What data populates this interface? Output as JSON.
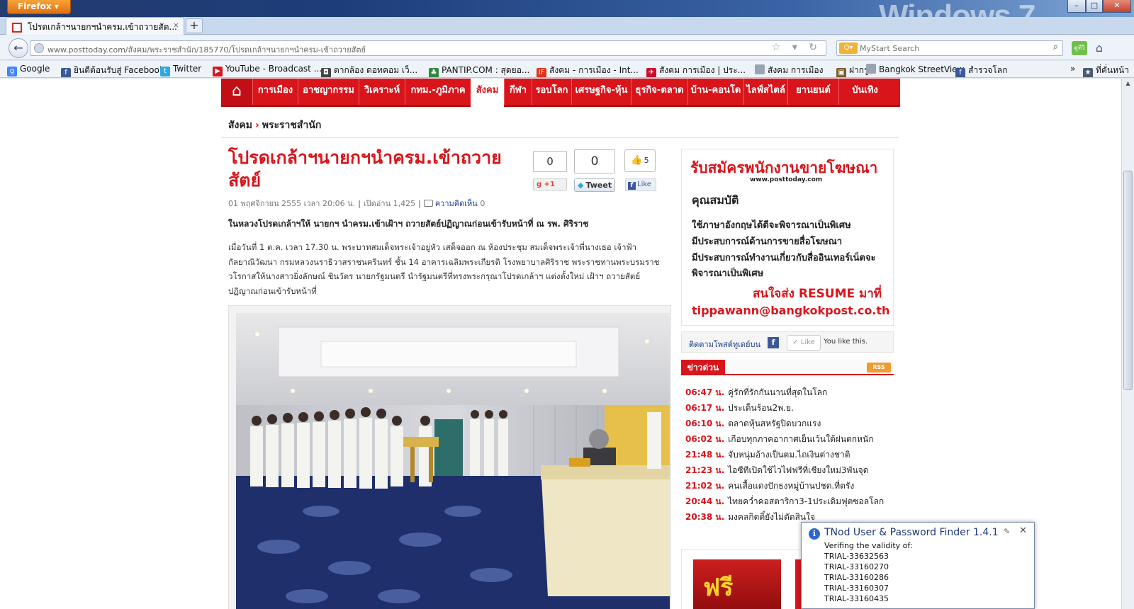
{
  "window": {
    "app_button": "Firefox",
    "os_logo": "Windows 7",
    "controls": {
      "minimize": "–",
      "restore": "□",
      "close": "✕"
    }
  },
  "tab": {
    "title": "โปรดเกล้าฯนายกฯนำครม.เข้าถวายสัต...",
    "close": "×",
    "new_tab": "+"
  },
  "nav": {
    "back": "←",
    "url": "www.posttoday.com/สังคม/พระราชสำนัก/185770/โปรดเกล้าฯนายกฯนำครม-เข้าถวายสัตย์",
    "url_icons": "☆ ▾ ↻",
    "search_placeholder": "MyStart Search",
    "search_icon": "⌕",
    "addon_label": "ดูทีวี",
    "home_icon": "⌂"
  },
  "bookmarks": [
    {
      "label": "Google",
      "icon": "google-icon",
      "color": "#4285f4",
      "glyph": "g"
    },
    {
      "label": "ยินดีต้อนรับสู่ Facebook",
      "icon": "facebook-icon",
      "color": "#3b5998",
      "glyph": "f"
    },
    {
      "label": "Twitter",
      "icon": "twitter-icon",
      "color": "#2fa8e0",
      "glyph": "t"
    },
    {
      "label": "YouTube - Broadcast ...",
      "icon": "youtube-icon",
      "color": "#d9151c",
      "glyph": "▶"
    },
    {
      "label": "ตากล้อง ดอทคอม เว็...",
      "icon": "camera-icon",
      "color": "#444444",
      "glyph": "◘"
    },
    {
      "label": "PANTIP.COM : สุดยอ...",
      "icon": "pantip-icon",
      "color": "#2e8b3e",
      "glyph": "♣"
    },
    {
      "label": "สังคม - การเมือง - Int...",
      "icon": "if-icon",
      "color": "#e3331c",
      "glyph": "IF"
    },
    {
      "label": "สังคม การเมือง | ประ...",
      "icon": "bird-icon",
      "color": "#c8102e",
      "glyph": "✈"
    },
    {
      "label": "สังคม การเมือง",
      "icon": "page-icon",
      "color": "#9aa4b0",
      "glyph": ""
    },
    {
      "label": "ฝากรูป",
      "icon": "photo-icon",
      "color": "#7a5c2e",
      "glyph": "▣"
    },
    {
      "label": "Bangkok StreetView",
      "icon": "page-icon",
      "color": "#9aa4b0",
      "glyph": ""
    },
    {
      "label": "สำรวจโลก",
      "icon": "facebook-icon",
      "color": "#3b5998",
      "glyph": "f"
    }
  ],
  "bookmarks_more": "»",
  "bookmarks_menu": "ที่คั่นหน้า",
  "site_nav": {
    "home_icon": "⌂",
    "items": [
      "การเมือง",
      "อาชญากรรม",
      "วิเคราะห์",
      "กทม.-ภูมิภาค",
      "สังคม",
      "กีฬา",
      "รอบโลก",
      "เศรษฐกิจ-หุ้น",
      "ธุรกิจ-ตลาด",
      "บ้าน-คอนโด",
      "ไลฟ์สไตล์",
      "ยานยนต์",
      "บันเทิง"
    ],
    "active": "สังคม"
  },
  "breadcrumb": {
    "section": "สังคม",
    "separator": "›",
    "subsection": "พระราชสำนัก"
  },
  "article": {
    "title": "โปรดเกล้าฯนายกฯนำครม.เข้าถวายสัตย์",
    "date": "01 พฤศจิกายน 2555 เวลา 20:06 น.",
    "views": "เปิดอ่าน 1,425",
    "comments_label": "ความคิดเห็น",
    "comments_count": "0",
    "lead": "ในหลวงโปรดเกล้าฯให้ นายกฯ นำครม.เข้าเฝ้าฯ ถวายสัตย์ปฏิญาณก่อนเข้ารับหน้าที่ ณ รพ. ศิริราช",
    "body": "เมื่อวันที่ 1 ต.ค. เวลา 17.30 น. พระบาทสมเด็จพระเจ้าอยู่หัว เสด็จออก ณ ห้องประชุม สมเด็จพระเจ้าพี่นางเธอ เจ้าฟ้ากัลยาณิวัฒนา กรมหลวงนราธิวาสราชนครินทร์ ชั้น 14 อาคารเฉลิมพระเกียรติ โรงพยาบาลศิริราช พระราชทานพระบรมราชวโรกาสให้นางสาวยิ่งลักษณ์ ชินวัตร นายกรัฐมนตรี นำรัฐมนตรีที่ทรงพระกรุณาโปรดเกล้าฯ แต่งตั้งใหม่ เฝ้าฯ ถวายสัตย์ปฏิญาณก่อนเข้ารับหน้าที่"
  },
  "share": {
    "gplus_count": "0",
    "gplus_label": "+1",
    "tweet_count": "0",
    "tweet_label": "Tweet",
    "like_count": "5",
    "like_label": "Like"
  },
  "ad": {
    "headline": "รับสมัครพนักงานขายโฆษณา",
    "site": "www.posttoday.com",
    "qualifications": "คุณสมบัติ",
    "lines": [
      "ใช้ภาษาอังกฤษได้ดีจะพิจารณาเป็นพิเศษ",
      "มีประสบการณ์ด้านการขายสื่อโฆษณา",
      "มีประสบการณ์ทำงานเกี่ยวกับสื่ออินเทอร์เน็ตจะ",
      "พิจารณาเป็นพิเศษ"
    ],
    "resume": "สนใจส่ง RESUME มาที่",
    "email": "tippawann@bangkokpost.co.th"
  },
  "follow": {
    "text": "ติดตามโพสต์ทูเดย์บน",
    "like_label": "Like",
    "you_like": "You like this."
  },
  "news": {
    "label": "ข่าวด่วน",
    "rss": "RSS",
    "items": [
      {
        "time": "06:47 น.",
        "headline": "คู่รักที่รักกันนานที่สุดในโลก"
      },
      {
        "time": "06:17 น.",
        "headline": "ประเด็นร้อน2พ.ย."
      },
      {
        "time": "06:10 น.",
        "headline": "ตลาดหุ้นสหรัฐปิดบวกแรง"
      },
      {
        "time": "06:02 น.",
        "headline": "เกือบทุกภาคอากาศเย็นเว้นใต้ฝนตกหนัก"
      },
      {
        "time": "21:48 น.",
        "headline": "จับหนุ่มอ้างเป็นตม.ไถเงินต่างชาติ"
      },
      {
        "time": "21:23 น.",
        "headline": "ไอซีทีเปิดใช้ไวไฟฟรีที่เชียงใหม่3พันจุด"
      },
      {
        "time": "21:02 น.",
        "headline": "คนเสื้อแดงปักธงหมู่บ้านปชต.ที่ตรัง"
      },
      {
        "time": "20:44 น.",
        "headline": "ไทยคว่ำคอสตาริกา3-1ประเดิมฟุตซอลโลก"
      },
      {
        "time": "20:38 น.",
        "headline": "มงคลกิตติ์ยังไม่ตัดสินใจ"
      }
    ]
  },
  "promo": {
    "text": "ฟรี"
  },
  "popup": {
    "title": "TNod User & Password Finder 1.4.1",
    "subtitle": "Verifing the validity of:",
    "lines": [
      "TRIAL-33632563",
      "TRIAL-33160270",
      "TRIAL-33160286",
      "TRIAL-33160307",
      "TRIAL-33160435"
    ],
    "pin": "✎",
    "close": "✕"
  }
}
